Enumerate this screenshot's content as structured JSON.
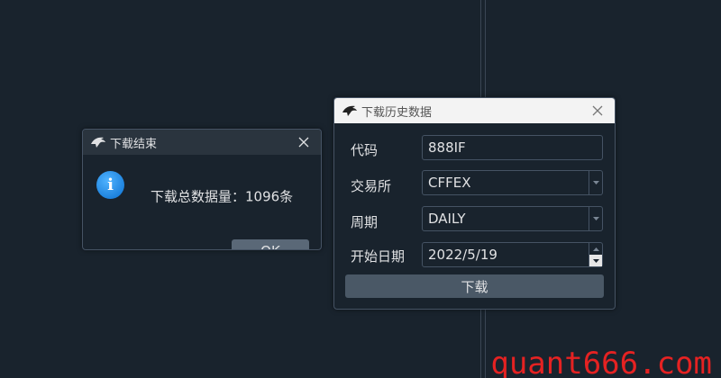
{
  "msgbox": {
    "title": "下载结束",
    "message": "下载总数据量：1096条",
    "ok_label": "OK",
    "icon": "info-icon"
  },
  "download_dialog": {
    "title": "下载历史数据",
    "fields": {
      "code_label": "代码",
      "code_value": "888IF",
      "exchange_label": "交易所",
      "exchange_value": "CFFEX",
      "interval_label": "周期",
      "interval_value": "DAILY",
      "start_label": "开始日期",
      "start_value": "2022/5/19"
    },
    "download_label": "下载"
  },
  "watermark": "quant666.com",
  "colors": {
    "background": "#19232d",
    "border": "#455364",
    "text": "#e0e1e3",
    "watermark": "#e52222"
  }
}
